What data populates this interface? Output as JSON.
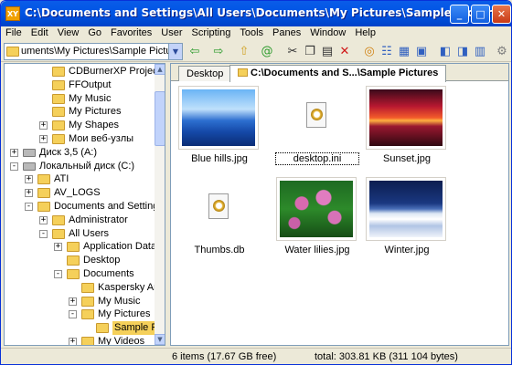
{
  "window": {
    "title": "C:\\Documents and Settings\\All Users\\Documents\\My Pictures\\Sample Pictures - XYpl...",
    "app_icon": "XY",
    "buttons": {
      "minimize": "_",
      "maximize": "□",
      "close": "✕"
    }
  },
  "menu": [
    "File",
    "Edit",
    "View",
    "Go",
    "Favorites",
    "User",
    "Scripting",
    "Tools",
    "Panes",
    "Window",
    "Help"
  ],
  "address": {
    "value": "uments\\My Pictures\\Sample Pictures\\"
  },
  "toolbar_icons": [
    "back-arrow-icon",
    "forward-arrow-icon",
    "up-folder-icon",
    "refresh-icon",
    "cut-icon",
    "copy-icon",
    "paste-icon",
    "delete-icon",
    "find-icon",
    "list-view-icon",
    "thumbnail-view-icon",
    "details-view-icon",
    "pane-left-icon",
    "pane-right-icon",
    "pane-dual-icon",
    "favorites-icon",
    "settings-icon"
  ],
  "tree": [
    {
      "label": "CDBurnerXP Projects",
      "indent": 2,
      "pm": "",
      "icon": "folder"
    },
    {
      "label": "FFOutput",
      "indent": 2,
      "pm": "",
      "icon": "folder"
    },
    {
      "label": "My Music",
      "indent": 2,
      "pm": "",
      "icon": "folder"
    },
    {
      "label": "My Pictures",
      "indent": 2,
      "pm": "",
      "icon": "folder"
    },
    {
      "label": "My Shapes",
      "indent": 2,
      "pm": "+",
      "icon": "folder"
    },
    {
      "label": "Мои веб-узлы",
      "indent": 2,
      "pm": "+",
      "icon": "folder"
    },
    {
      "label": "Диск 3,5 (A:)",
      "indent": 0,
      "pm": "+",
      "icon": "drive"
    },
    {
      "label": "Локальный диск (C:)",
      "indent": 0,
      "pm": "−",
      "icon": "drive"
    },
    {
      "label": "ATI",
      "indent": 1,
      "pm": "+",
      "icon": "folder"
    },
    {
      "label": "AV_LOGS",
      "indent": 1,
      "pm": "+",
      "icon": "folder"
    },
    {
      "label": "Documents and Settings",
      "indent": 1,
      "pm": "−",
      "icon": "folder"
    },
    {
      "label": "Administrator",
      "indent": 2,
      "pm": "+",
      "icon": "folder"
    },
    {
      "label": "All Users",
      "indent": 2,
      "pm": "−",
      "icon": "folder"
    },
    {
      "label": "Application Data",
      "indent": 3,
      "pm": "+",
      "icon": "folder"
    },
    {
      "label": "Desktop",
      "indent": 3,
      "pm": "",
      "icon": "folder"
    },
    {
      "label": "Documents",
      "indent": 3,
      "pm": "−",
      "icon": "folder"
    },
    {
      "label": "Kaspersky Ant",
      "indent": 4,
      "pm": "",
      "icon": "folder"
    },
    {
      "label": "My Music",
      "indent": 4,
      "pm": "+",
      "icon": "folder"
    },
    {
      "label": "My Pictures",
      "indent": 4,
      "pm": "−",
      "icon": "folder"
    },
    {
      "label": "Sample Pic",
      "indent": 5,
      "pm": "",
      "icon": "folder",
      "selected": true
    },
    {
      "label": "My Videos",
      "indent": 4,
      "pm": "+",
      "icon": "folder"
    }
  ],
  "tabs": [
    "Desktop",
    "C:\\Documents and S...\\Sample Pictures"
  ],
  "files": [
    {
      "name": "Blue hills.jpg",
      "kind": "hills"
    },
    {
      "name": "desktop.ini",
      "kind": "file",
      "selected": true
    },
    {
      "name": "Sunset.jpg",
      "kind": "sunset"
    },
    {
      "name": "Thumbs.db",
      "kind": "file"
    },
    {
      "name": "Water lilies.jpg",
      "kind": "lilies"
    },
    {
      "name": "Winter.jpg",
      "kind": "winter"
    }
  ],
  "status": {
    "left": "6 items (17.67 GB free)",
    "right": "total: 303.81 KB (311 104 bytes)"
  },
  "colors": {
    "titlebar": "#0055e5",
    "selection": "#f5d05a",
    "chrome": "#ece9d8"
  }
}
